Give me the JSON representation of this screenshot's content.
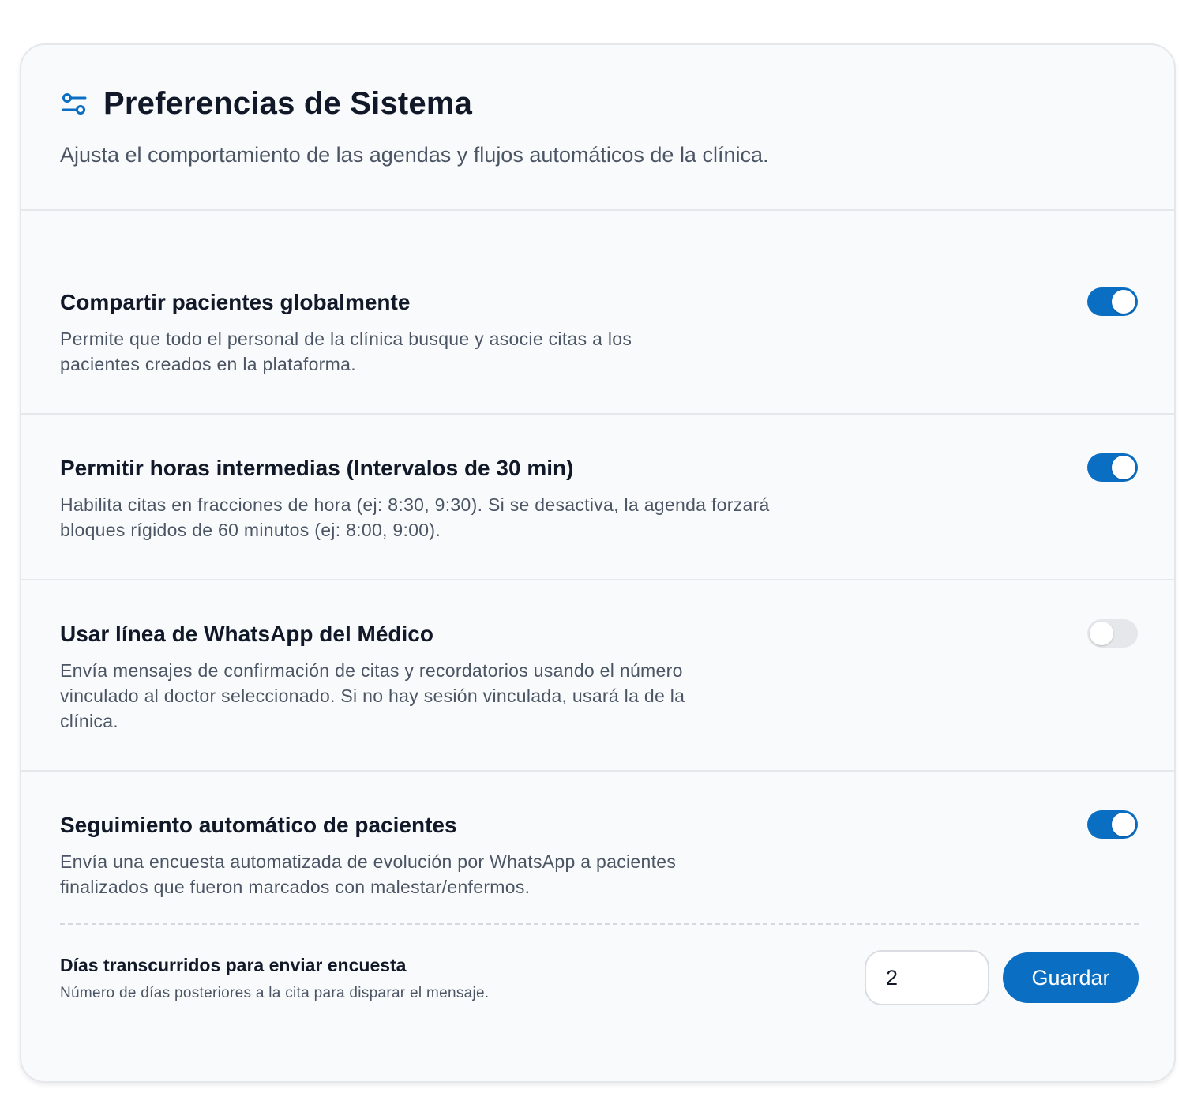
{
  "header": {
    "title": "Preferencias de Sistema",
    "subtitle": "Ajusta el comportamiento de las agendas y flujos automáticos de la clínica."
  },
  "settings": [
    {
      "title": "Compartir pacientes globalmente",
      "description": "Permite que todo el personal de la clínica busque y asocie citas a los pacientes creados en la plataforma.",
      "enabled": true
    },
    {
      "title": "Permitir horas intermedias (Intervalos de 30 min)",
      "description": "Habilita citas en fracciones de hora (ej: 8:30, 9:30). Si se desactiva, la agenda forzará bloques rígidos de 60 minutos (ej: 8:00, 9:00).",
      "enabled": true
    },
    {
      "title": "Usar línea de WhatsApp del Médico",
      "description": "Envía mensajes de confirmación de citas y recordatorios usando el número vinculado al doctor seleccionado. Si no hay sesión vinculada, usará la de la clínica.",
      "enabled": false
    },
    {
      "title": "Seguimiento automático de pacientes",
      "description": "Envía una encuesta automatizada de evolución por WhatsApp a pacientes finalizados que fueron marcados con malestar/enfermos.",
      "enabled": true
    }
  ],
  "survey": {
    "title": "Días transcurridos para enviar encuesta",
    "description": "Número de días posteriores a la cita para disparar el mensaje.",
    "days_value": "2",
    "save_label": "Guardar"
  },
  "colors": {
    "accent": "#0a6ec3",
    "toggle_off": "#e5e7eb"
  }
}
